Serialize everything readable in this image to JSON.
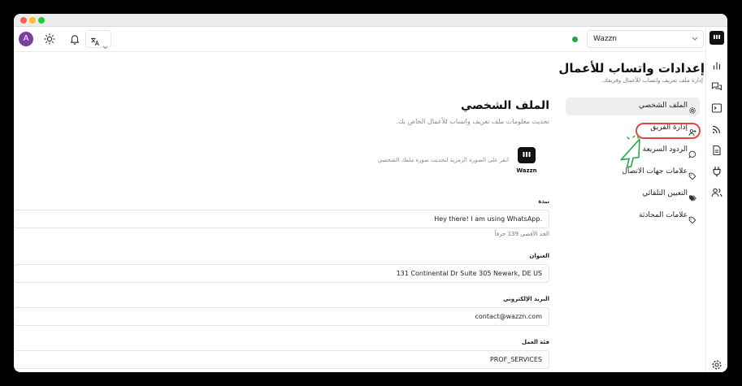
{
  "window": {
    "traffic_lights": [
      "#ff5f57",
      "#febc2e",
      "#28c840"
    ]
  },
  "topbar": {
    "avatar_letter": "A",
    "icons": [
      "sun-icon",
      "bell-icon",
      "translate-icon",
      "chevron-down-icon"
    ],
    "status_color": "#22a845",
    "workspace_select": {
      "value": "Wazzn"
    }
  },
  "rail": {
    "icons": [
      "app-logo-icon",
      "bar-chart-icon",
      "chat-bubbles-icon",
      "terminal-icon",
      "broadcast-icon",
      "document-icon",
      "plug-icon",
      "users-icon",
      "gear-icon"
    ]
  },
  "sidepane": {
    "title": "إعدادات واتساب للأعمال",
    "subtitle": "إدارة ملف تعريف واتساب للأعمال وفريقك.",
    "items": [
      {
        "label": "الملف الشخصي",
        "icon": "settings-icon",
        "active": true
      },
      {
        "label": "إدارة الفريق",
        "icon": "user-plus-icon",
        "active": false
      },
      {
        "label": "الردود السريعة",
        "icon": "message-circle-icon",
        "active": false
      },
      {
        "label": "علامات جهات الاتصال",
        "icon": "tag-icon",
        "active": false
      },
      {
        "label": "التعيين التلقائي",
        "icon": "tags-icon",
        "active": false
      },
      {
        "label": "علامات المحادثة",
        "icon": "tag-icon",
        "active": false
      }
    ]
  },
  "main": {
    "title": "الملف الشخصي",
    "subtitle": "تحديث معلومات ملف تعريف واتساب للأعمال الخاص بك.",
    "logo_text": "Wazzn",
    "logo_hint": "انقر على الصورة الرمزية لتحديث صورة ملفك الشخصي",
    "about": {
      "label": "نبذة",
      "value": "Hey there! I am using WhatsApp.",
      "counter": "الحد الأقصى 139 حرفاً"
    },
    "address": {
      "label": "العنوان",
      "value": "131 Continental Dr  Suite 305  Newark, DE US"
    },
    "email": {
      "label": "البريد الإلكتروني",
      "value": "contact@wazzn.com"
    },
    "category": {
      "label": "فئة العمل",
      "value": "PROF_SERVICES"
    }
  },
  "annotation": {
    "highlight_color": "#e34545",
    "cursor_color": "#2aa84a"
  }
}
